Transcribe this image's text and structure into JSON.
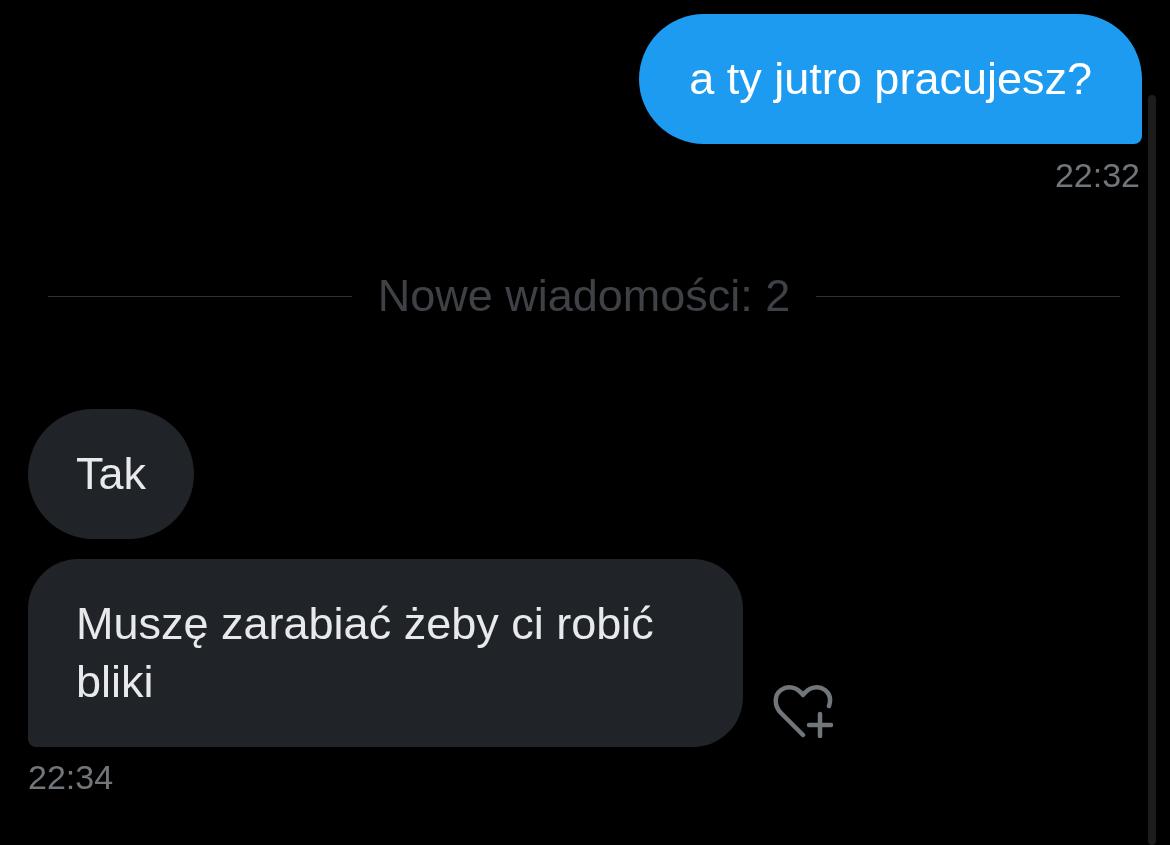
{
  "conversation": [
    {
      "kind": "sent",
      "text": "a ty jutro pracujesz?",
      "time": "22:32"
    },
    {
      "kind": "divider",
      "label": "Nowe wiadomości: 2"
    },
    {
      "kind": "received",
      "text": "Tak"
    },
    {
      "kind": "received",
      "text": "Muszę zarabiać żeby ci robić bliki",
      "time": "22:34",
      "reaction_button": true
    }
  ]
}
